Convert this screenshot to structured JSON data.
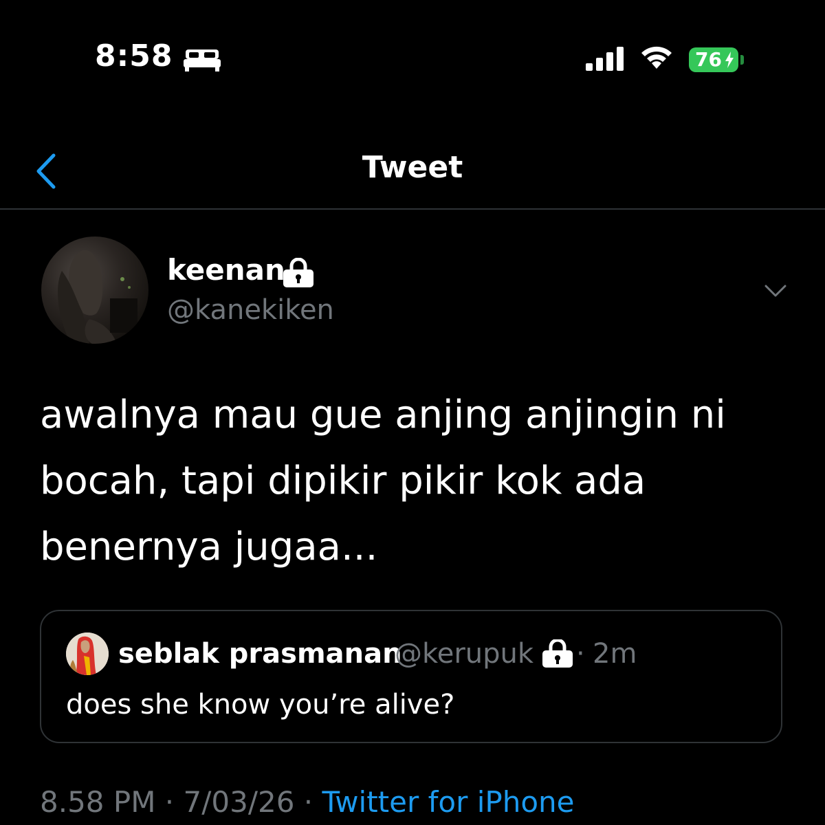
{
  "status_bar": {
    "time": "8:58",
    "battery": "76",
    "battery_color": "#35c759",
    "icons": [
      "bed-icon",
      "signal-icon",
      "wifi-icon",
      "bolt-icon"
    ]
  },
  "nav": {
    "title": "Tweet",
    "back_icon": "chevron-left-icon",
    "accent_color": "#1d9bf0"
  },
  "tweet": {
    "author_name": "keenan",
    "author_handle": "@kanekiken",
    "protected": true,
    "text": "awalnya mau gue anjing anjingin ni bocah, tapi dipikir pikir kok ada benernya jugaa...",
    "quote": {
      "author_name": "seblak prasmanan",
      "author_handle": "@kerupuk",
      "protected": true,
      "separator": "·",
      "time": "2m",
      "text": "does she know you’re alive?"
    },
    "footer": {
      "time": "8.58 PM",
      "sep1": " · ",
      "date": "7/03/26",
      "sep2": " · ",
      "source": "Twitter for iPhone"
    }
  }
}
